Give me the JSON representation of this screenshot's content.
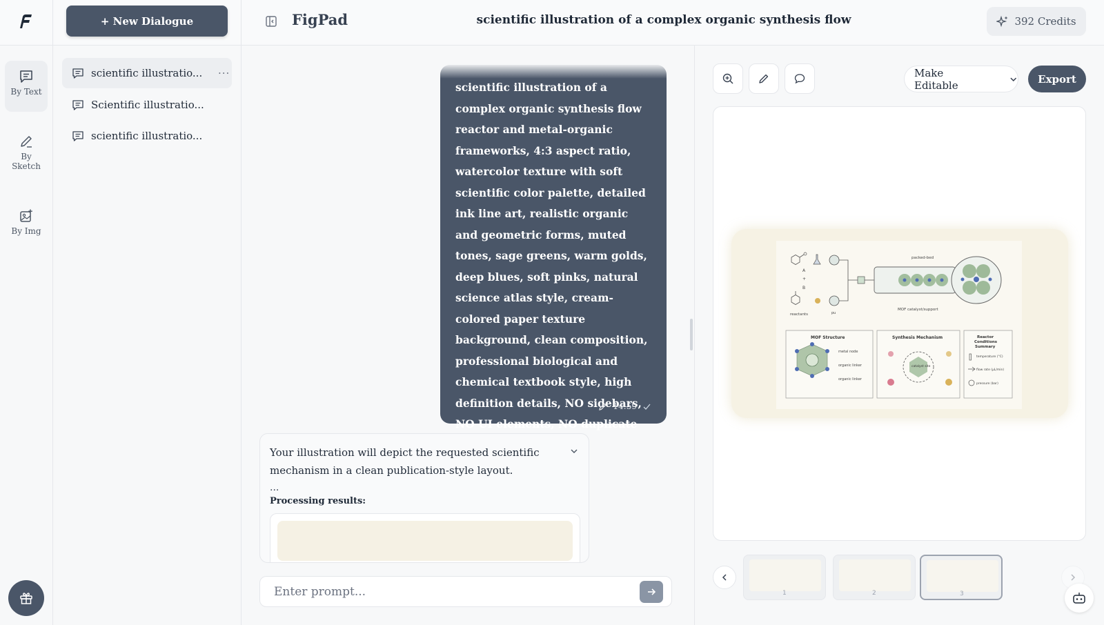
{
  "app": {
    "brand": "FigPad",
    "new_dialogue_label": "+ New Dialogue",
    "document_title": "scientific illustration of a complex organic synthesis flow",
    "credits_label": "392 Credits"
  },
  "rail": {
    "items": [
      {
        "label": "By Text",
        "icon": "chat-text-icon",
        "active": true
      },
      {
        "label": "By Sketch",
        "icon": "pen-icon",
        "active": false
      },
      {
        "label": "By Img",
        "icon": "image-add-icon",
        "active": false
      }
    ]
  },
  "history": {
    "items": [
      {
        "label": "scientific illustratio...",
        "active": true,
        "more": "···"
      },
      {
        "label": "Scientific illustratio...",
        "active": false
      },
      {
        "label": "scientific illustratio...",
        "active": false
      }
    ]
  },
  "chat": {
    "user_message": "scientific illustration of a complex organic synthesis flow reactor and metal-organic frameworks, 4:3 aspect ratio, watercolor texture with soft scientific color palette, detailed ink line art, realistic organic and geometric forms, muted tones, sage greens, warm golds, deep blues, soft pinks, natural science atlas style, cream-colored paper texture background, clean composition, professional biological and chemical textbook style, high definition details, NO sidebars, NO UI elements, NO duplicate icons.",
    "user_time": "14:59",
    "reply_text": "Your illustration will depict the requested scientific mechanism in a clean publication-style layout.",
    "reply_ellipsis": "...",
    "processing_label": "Processing results:",
    "prompt_placeholder": "Enter prompt..."
  },
  "toolbar": {
    "make_editable_label": "Make Editable",
    "export_label": "Export"
  },
  "figure": {
    "labels": {
      "a": "A",
      "plus": "+",
      "b": "B",
      "reactants": "reactants",
      "pu": "pu",
      "packed_bed": "packed-bed",
      "mof_support": "MOF catalyst/support",
      "panel1_title": "MOF Structure",
      "panel2_title": "Synthesis Mechanism",
      "panel3_title_1": "Reactor",
      "panel3_title_2": "Conditions",
      "panel3_title_3": "Summary",
      "metal_node": "metal node",
      "organic_linker": "organic linker",
      "catalyst_site": "catalyst site",
      "temperature": "temperature (°C)",
      "flow_rate": "flow rate (µL/min)",
      "pressure": "pressure (bar)"
    }
  },
  "gallery": {
    "thumbnails": [
      {
        "num": "1",
        "active": false
      },
      {
        "num": "2",
        "active": false
      },
      {
        "num": "3",
        "active": true
      }
    ]
  },
  "colors": {
    "primary": "#4a5668",
    "paper": "#f6f2e4",
    "sage": "#8fb08a",
    "gold": "#d9b25a",
    "blue": "#4f6db3",
    "pink": "#d97b8f"
  }
}
